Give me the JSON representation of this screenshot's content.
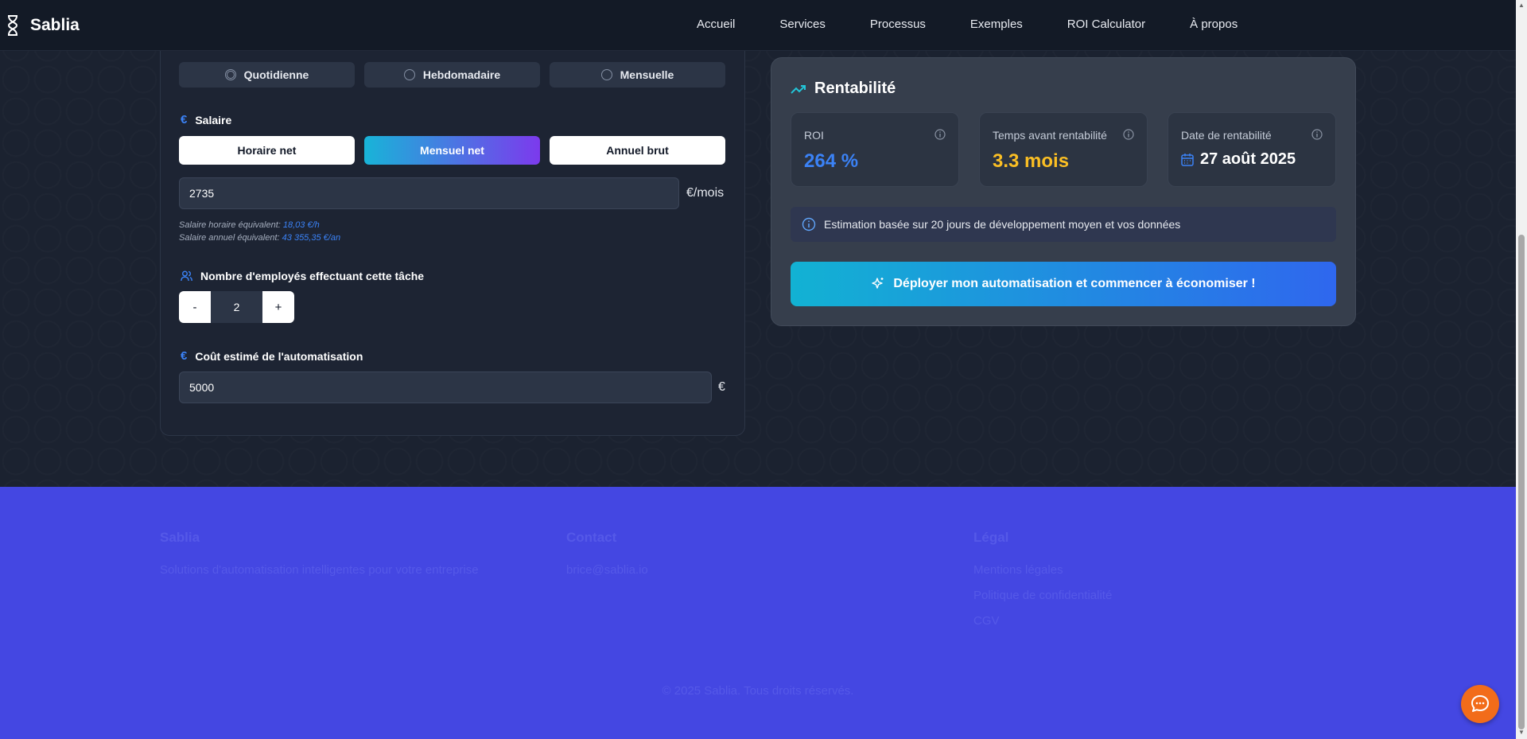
{
  "header": {
    "brand": "Sablia",
    "nav": [
      "Accueil",
      "Services",
      "Processus",
      "Exemples",
      "ROI Calculator",
      "À propos"
    ]
  },
  "form": {
    "frequency_options": [
      "Quotidienne",
      "Hebdomadaire",
      "Mensuelle"
    ],
    "frequency_selected": "Quotidienne",
    "salary_label": "Salaire",
    "salary_types": [
      "Horaire net",
      "Mensuel net",
      "Annuel brut"
    ],
    "salary_type_selected": "Mensuel net",
    "salary_value": "2735",
    "salary_unit": "€/mois",
    "hourly_hint_label": "Salaire horaire équivalent:",
    "hourly_hint_value": "18,03 €/h",
    "annual_hint_label": "Salaire annuel équivalent:",
    "annual_hint_value": "43 355,35 €/an",
    "employees_label": "Nombre d'employés effectuant cette tâche",
    "employees_minus": "-",
    "employees_value": "2",
    "employees_plus": "+",
    "cost_label": "Coût estimé de l'automatisation",
    "cost_value": "5000",
    "cost_unit": "€"
  },
  "results": {
    "title": "Rentabilité",
    "roi_label": "ROI",
    "roi_value": "264 %",
    "time_label": "Temps avant rentabilité",
    "time_value": "3.3 mois",
    "date_label": "Date de rentabilité",
    "date_value": "27 août 2025",
    "note": "Estimation basée sur 20 jours de développement moyen et vos données",
    "deploy_label": "Déployer mon automatisation et commencer à économiser !"
  },
  "footer": {
    "col1_title": "Sablia",
    "col1_text": "Solutions d'automatisation intelligentes pour votre entreprise",
    "col2_title": "Contact",
    "col2_text": "brice@sablia.io",
    "col3_title": "Légal",
    "col3_links": [
      "Mentions légales",
      "Politique de confidentialité",
      "CGV"
    ],
    "copyright": "© 2025 Sablia. Tous droits réservés."
  },
  "colors": {
    "roi": "#3b82f6",
    "time": "#fbbf24",
    "footer_bg": "#4447e2",
    "chat": "#f26c1a"
  }
}
